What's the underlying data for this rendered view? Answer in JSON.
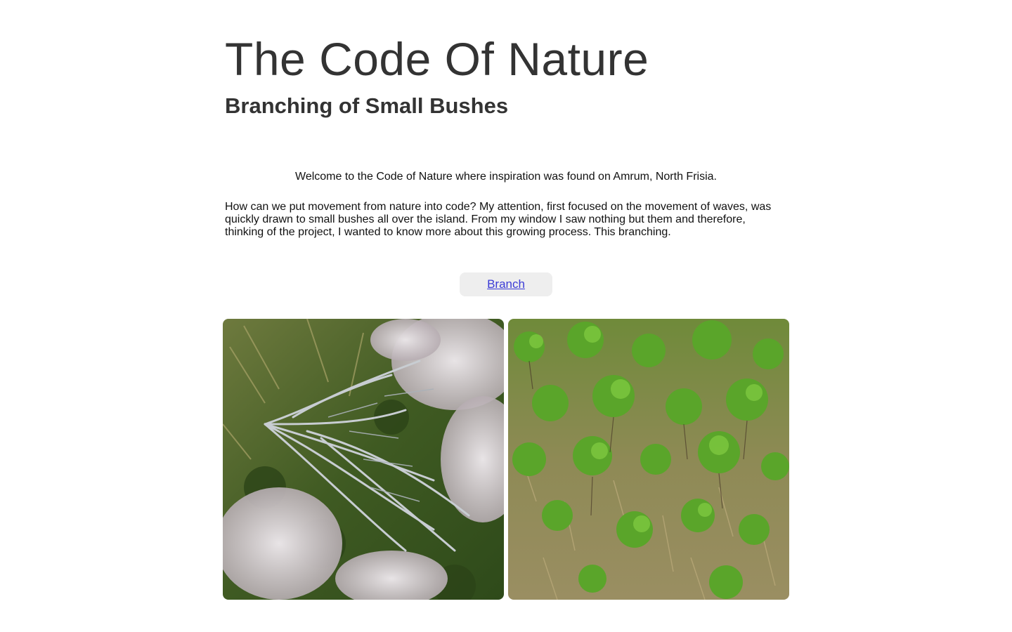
{
  "header": {
    "title": "The Code Of Nature",
    "subtitle": "Branching of Small Bushes"
  },
  "content": {
    "welcome": "Welcome to the Code of Nature where inspiration was found on Amrum, North Frisia.",
    "intro": "How can we put movement from nature into code? My attention, first focused on the movement of waves, was quickly drawn to small bushes all over the island. From my window I saw nothing but them and therefore, thinking of the project, I wanted to know more about this growing process. This branching."
  },
  "actions": {
    "branch_label": "Branch"
  },
  "gallery": {
    "images": [
      {
        "subject": "silver-heather-bush-photo"
      },
      {
        "subject": "green-shrub-field-photo"
      }
    ]
  },
  "colors": {
    "text": "#333333",
    "body_text": "#111111",
    "link": "#3b3bd6",
    "button_bg": "#eeeeee"
  }
}
